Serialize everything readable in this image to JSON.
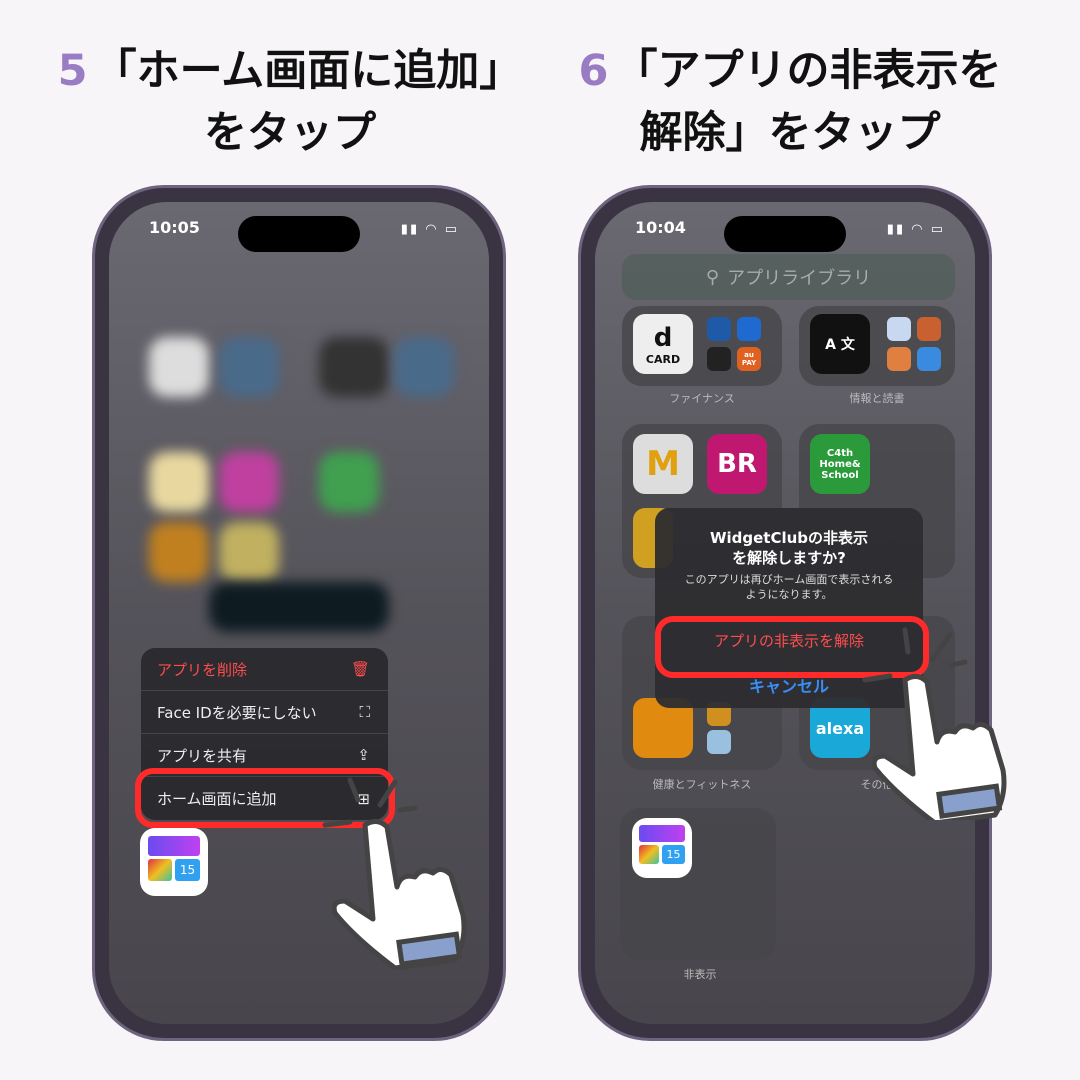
{
  "steps": [
    {
      "number": "5",
      "title_line1": "「ホーム画面に追加」",
      "title_line2": "をタップ"
    },
    {
      "number": "6",
      "title_line1": "「アプリの非表示を",
      "title_line2": "解除」をタップ"
    }
  ],
  "left_phone": {
    "time": "10:05",
    "menu": [
      {
        "label": "アプリを削除",
        "icon": "trash-icon",
        "destructive": true
      },
      {
        "label": "Face IDを必要にしない",
        "icon": "face-id-icon"
      },
      {
        "label": "アプリを共有",
        "icon": "share-icon"
      },
      {
        "label": "ホーム画面に追加",
        "icon": "add-square-icon",
        "highlighted": true
      }
    ],
    "app_badge": "15"
  },
  "right_phone": {
    "time": "10:04",
    "search_placeholder": "アプリライブラリ",
    "folders": [
      "ファイナンス",
      "情報と読書",
      "健康とフィットネス",
      "その他",
      "非表示"
    ],
    "icons": {
      "dcard_d": "d",
      "dcard": "CARD",
      "aupay": "au PAY",
      "mcd": "M",
      "br": "BR",
      "c4th": "C4th Home& School",
      "alexa": "alexa",
      "translate": "A 文",
      "widget_badge": "15"
    },
    "dialog": {
      "title": "WidgetClubの非表示を解除しますか?",
      "title_line1": "WidgetClubの非表示",
      "title_line2": "を解除しますか?",
      "message_line1": "このアプリは再びホーム画面で表示される",
      "message_line2": "ようになります。",
      "confirm": "アプリの非表示を解除",
      "cancel": "キャンセル"
    }
  },
  "colors": {
    "accent_number": "#9a7cc4",
    "highlight": "#ff2a2a",
    "destructive": "#ff4d4d",
    "link": "#3a8ef6"
  }
}
